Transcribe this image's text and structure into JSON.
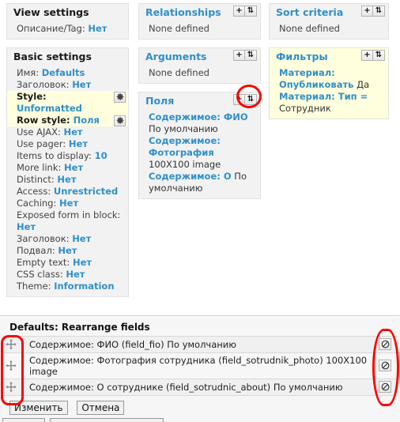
{
  "top_region": {
    "columns": [
      {
        "name": "column-left",
        "panels": [
          {
            "id": "view-settings",
            "title": "View settings",
            "title_style": "dark",
            "has_actions": false,
            "rows": [
              {
                "label": "Описание/Tag:",
                "value": "Нет",
                "value_link": true
              }
            ]
          },
          {
            "id": "basic-settings",
            "title": "Basic settings",
            "title_style": "dark",
            "has_actions": false,
            "rows": [
              {
                "label": "Имя:",
                "value": "Defaults",
                "value_link": true
              },
              {
                "label": "Заголовок:",
                "value": "Нет",
                "value_link": true
              },
              {
                "label": "Style:",
                "value": "Unformatted",
                "value_link": true,
                "highlight": true,
                "gear": true
              },
              {
                "label": "Row style:",
                "value": "Поля",
                "value_link": true,
                "highlight": true,
                "gear": true
              },
              {
                "label": "Use AJAX:",
                "value": "Нет",
                "value_link": true
              },
              {
                "label": "Use pager:",
                "value": "Нет",
                "value_link": true
              },
              {
                "label": "Items to display:",
                "value": "10",
                "value_link": true
              },
              {
                "label": "More link:",
                "value": "Нет",
                "value_link": true
              },
              {
                "label": "Distinct:",
                "value": "Нет",
                "value_link": true
              },
              {
                "label": "Access:",
                "value": "Unrestricted",
                "value_link": true
              },
              {
                "label": "Caching:",
                "value": "Нет",
                "value_link": true
              },
              {
                "label": "Exposed form in block:",
                "value": "Нет",
                "value_link": true
              },
              {
                "label": "Заголовок:",
                "value": "Нет",
                "value_link": true
              },
              {
                "label": "Подвал:",
                "value": "Нет",
                "value_link": true
              },
              {
                "label": "Empty text:",
                "value": "Нет",
                "value_link": true
              },
              {
                "label": "CSS class:",
                "value": "Нет",
                "value_link": true
              },
              {
                "label": "Theme:",
                "value": "Information",
                "value_link": true
              }
            ]
          }
        ]
      },
      {
        "name": "column-middle",
        "panels": [
          {
            "id": "relationships",
            "title": "Relationships",
            "title_style": "link",
            "has_actions": true,
            "add_label": "+",
            "sort_label": "⇅",
            "empty_text": "None defined"
          },
          {
            "id": "arguments",
            "title": "Arguments",
            "title_style": "link",
            "has_actions": true,
            "add_label": "+",
            "sort_label": "⇅",
            "empty_text": "None defined"
          },
          {
            "id": "fields",
            "title": "Поля",
            "title_style": "link",
            "has_actions": true,
            "add_label": "+",
            "sort_label": "⇅",
            "items": [
              {
                "link": "Содержимое: ФИО",
                "rest": "По умолчанию"
              },
              {
                "link": "Содержимое: Фотография",
                "rest": "100X100 image"
              },
              {
                "link": "Содержимое: О",
                "rest": "По умолчанию"
              }
            ]
          }
        ]
      },
      {
        "name": "column-right",
        "panels": [
          {
            "id": "sort-criteria",
            "title": "Sort criteria",
            "title_style": "link",
            "has_actions": true,
            "add_label": "+",
            "sort_label": "⇅",
            "empty_text": "None defined"
          },
          {
            "id": "filters",
            "title": "Фильтры",
            "title_style": "link",
            "has_actions": true,
            "add_label": "+",
            "sort_label": "⇅",
            "yellow": true,
            "items": [
              {
                "link": "Материал: Опубликовать",
                "rest": "Да"
              },
              {
                "link": "Материал: Тип =",
                "rest": "Сотрудник"
              }
            ]
          }
        ]
      }
    ]
  },
  "bottom_region": {
    "title": "Defaults: Rearrange fields",
    "rows": [
      {
        "drag_icon": "move-handle-icon",
        "text": "Содержимое: ФИО (field_fio) По умолчанию",
        "delete_icon": "no-entry-icon"
      },
      {
        "drag_icon": "move-handle-icon",
        "text": "Содержимое: Фотография сотрудника (field_sotrudnik_photo) 100X100 image",
        "delete_icon": "no-entry-icon"
      },
      {
        "drag_icon": "move-handle-icon",
        "text": "Содержимое: О сотруднике (field_sotrudnic_about) По умолчанию",
        "delete_icon": "no-entry-icon"
      }
    ],
    "buttons": [
      {
        "id": "submit",
        "label": "Изменить"
      },
      {
        "id": "cancel",
        "label": "Отмена"
      }
    ]
  },
  "annotations": {
    "marker_color": "#ff0000",
    "markers": [
      {
        "name": "fields-sort-button-highlight",
        "shape": "circle"
      },
      {
        "name": "drag-handles-column-highlight",
        "shape": "rounded-rect"
      },
      {
        "name": "delete-buttons-column-highlight",
        "shape": "rounded-rect"
      }
    ]
  },
  "colors": {
    "link_blue": "#2f8fc9",
    "panel_bg": "#f2f2f2",
    "highlight_yellow": "#ffffdd",
    "marker_red": "#ff0000"
  }
}
